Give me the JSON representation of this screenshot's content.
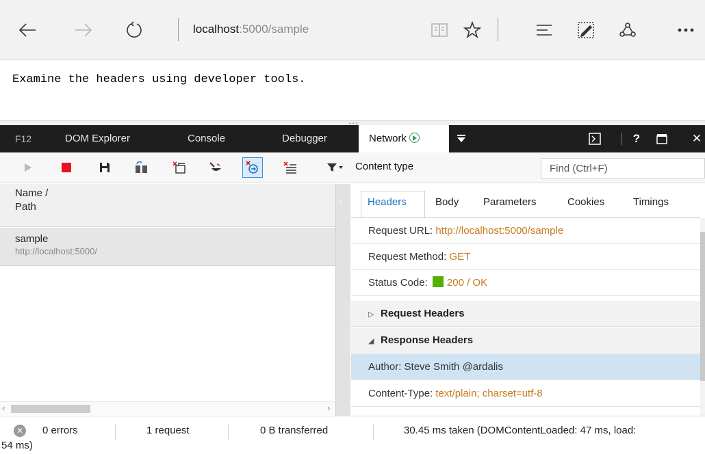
{
  "browser": {
    "url_host": "localhost",
    "url_path": ":5000/sample",
    "icons": [
      "back-arrow-icon",
      "forward-arrow-icon",
      "refresh-icon",
      "reading-view-icon",
      "favorite-star-icon",
      "hub-icon",
      "web-note-icon",
      "share-icon",
      "more-icon"
    ]
  },
  "page": {
    "text": "Examine the headers using developer tools."
  },
  "devtools": {
    "tabs": {
      "f12": "F12",
      "dom_explorer": "DOM Explorer",
      "console": "Console",
      "debugger": "Debugger",
      "network": "Network"
    },
    "help": "?",
    "close": "✕"
  },
  "toolbar": {
    "filter_label": "Content type",
    "find_placeholder": "Find (Ctrl+F)"
  },
  "request_list": {
    "header_line1": "Name /",
    "header_line2": "Path",
    "rows": [
      {
        "name": "sample",
        "path": "http://localhost:5000/"
      }
    ]
  },
  "details": {
    "tabs": [
      "Headers",
      "Body",
      "Parameters",
      "Cookies",
      "Timings"
    ],
    "request_url_label": "Request URL:",
    "request_url_value": "http://localhost:5000/sample",
    "request_method_label": "Request Method:",
    "request_method_value": "GET",
    "status_code_label": "Status Code:",
    "status_code_value": "200 / OK",
    "status_color": "#53b000",
    "request_headers_label": "Request Headers",
    "response_headers_label": "Response Headers",
    "response_headers": [
      {
        "text": "Author: Steve Smith @ardalis"
      },
      {
        "label": "Content-Type:",
        "value": "text/plain; charset=utf-8"
      }
    ]
  },
  "status_bar": {
    "errors": "0 errors",
    "requests": "1 request",
    "transferred": "0 B transferred",
    "timing_line1": "30.45 ms taken (DOMContentLoaded: 47 ms, load:",
    "timing_line2": "54 ms)"
  }
}
